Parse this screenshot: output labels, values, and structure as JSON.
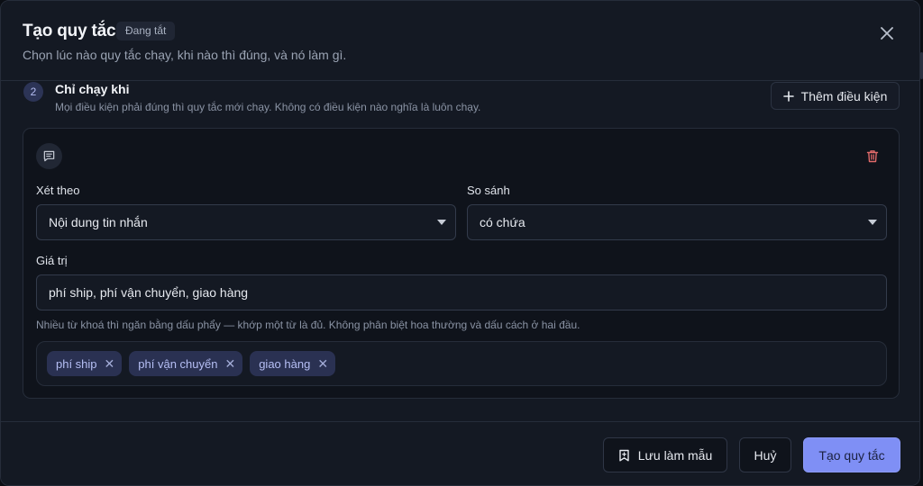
{
  "header": {
    "title": "Tạo quy tắc",
    "status_badge": "Đang tắt",
    "subtitle": "Chọn lúc nào quy tắc chạy, khi nào thì đúng, và nó làm gì."
  },
  "step": {
    "number": "2",
    "title": "Chỉ chạy khi",
    "description": "Mọi điều kiện phải đúng thì quy tắc mới chạy. Không có điều kiện nào nghĩa là luôn chạy.",
    "add_condition_label": "Thêm điều kiện"
  },
  "condition": {
    "field_label": "Xét theo",
    "field_value": "Nội dung tin nhắn",
    "operator_label": "So sánh",
    "operator_value": "có chứa",
    "value_label": "Giá trị",
    "value_input": "phí ship, phí vận chuyển, giao hàng",
    "hint": "Nhiều từ khoá thì ngăn bằng dấu phẩy — khớp một từ là đủ. Không phân biệt hoa thường và dấu cách ở hai đầu.",
    "tags": [
      "phí ship",
      "phí vận chuyển",
      "giao hàng"
    ]
  },
  "footer": {
    "save_template_label": "Lưu làm mẫu",
    "cancel_label": "Huỷ",
    "create_label": "Tạo quy tắc"
  },
  "icons": {
    "close": "close-icon",
    "plus": "plus-icon",
    "message": "message-icon",
    "delete": "trash-icon",
    "bookmark": "bookmark-icon",
    "remove_tag": "x-icon"
  },
  "colors": {
    "accent": "#7f8ff5",
    "danger": "#e06a6a",
    "tag_bg": "#2a3152",
    "tag_text": "#b6bff5"
  }
}
